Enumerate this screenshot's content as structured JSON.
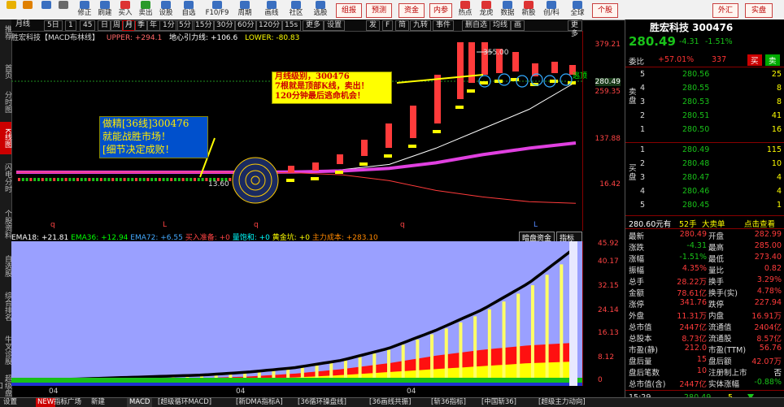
{
  "toolbar": {
    "buttons": [
      "",
      "修正",
      "刷建",
      "买入",
      "卖出",
      "设股",
      "自选",
      "F10/F9",
      "周期",
      "画线",
      "社区",
      "选股"
    ],
    "right_buttons": [
      "组报",
      "预测",
      "资金",
      "内参",
      "热点",
      "龙虎",
      "数据",
      "新股",
      "创/科",
      "全球",
      "个股",
      "外汇",
      "实盘"
    ]
  },
  "sidebar": [
    "推荐",
    "首页",
    "分时图",
    "K线图",
    "闪电分时",
    "个股资料",
    "自选股",
    "综合排名",
    "牛叉诊股",
    "超级盘口"
  ],
  "periods": [
    "月线",
    "5日",
    "1",
    "45",
    "日",
    "周",
    "月",
    "季",
    "年",
    "1分",
    "5分",
    "15分",
    "30分",
    "60分",
    "120分",
    "15s",
    "更多",
    "设置"
  ],
  "period_right": [
    "发",
    "F",
    "简",
    "九转",
    "事件",
    "删自选",
    "均线",
    "画",
    "更多"
  ],
  "stock": {
    "name": "胜宏科技",
    "code": "300476",
    "price": "280.49",
    "change": "-4.31",
    "pct": "-1.51%"
  },
  "indicator_line": {
    "label": "胜宏科技【MACD布林线】",
    "upper": "UPPER: +294.1",
    "center": "地心引力线: +106.6",
    "lower": "LOWER: -80.83"
  },
  "price_axis": [
    "379.21",
    "280.49",
    "259.35",
    "137.88",
    "16.42"
  ],
  "annotations": {
    "max_label": "355.00",
    "min_label": "13.60",
    "escape_label": "逃顶",
    "callout1": [
      "做精[36线]300476",
      "就能战胜市场！",
      "[细节决定成败！"
    ],
    "callout2": [
      "月线级别，300476",
      "7根就是顶部K线，卖出！",
      "120分钟最后逃命机会！"
    ],
    "time_marks": [
      "q",
      "L",
      "q",
      "q",
      "L"
    ]
  },
  "sub_header": {
    "items": [
      "EMA18: +21.81",
      "EMA36: +12.94",
      "EMA72: +6.55",
      "买入准备: +0",
      "量饱和: +0",
      "黄金坑: +0",
      "主力成本: +283.10"
    ],
    "buttons": [
      "暗盘资金",
      "指标说明"
    ]
  },
  "sub_axis": [
    "45.92",
    "40.17",
    "32.15",
    "24.14",
    "16.13",
    "8.12",
    "0"
  ],
  "x_labels": [
    "04",
    "04",
    "04"
  ],
  "quote": {
    "title": "胜宏科技 300476",
    "price": "280.49",
    "chg": "-4.31",
    "pct": "-1.51%",
    "weibi_label": "委比",
    "weibi": "+57.01%",
    "weicha": "337",
    "buy": "买",
    "sell": "卖",
    "sell_side": "卖盘",
    "buy_side": "买盘",
    "asks": [
      [
        "5",
        "280.56",
        "25"
      ],
      [
        "4",
        "280.55",
        "8"
      ],
      [
        "3",
        "280.53",
        "8"
      ],
      [
        "2",
        "280.51",
        "41"
      ],
      [
        "1",
        "280.50",
        "16"
      ]
    ],
    "bids": [
      [
        "1",
        "280.49",
        "115"
      ],
      [
        "2",
        "280.48",
        "10"
      ],
      [
        "3",
        "280.47",
        "4"
      ],
      [
        "4",
        "280.46",
        "4"
      ],
      [
        "5",
        "280.45",
        "1"
      ]
    ],
    "big_order": "280.60元有",
    "big_hand": "52手",
    "big_flag": "大卖单",
    "click": "点击查看",
    "stats": [
      [
        "最新",
        "280.49",
        "开盘",
        "282.99"
      ],
      [
        "涨跌",
        "-4.31",
        "最高",
        "285.00"
      ],
      [
        "涨幅",
        "-1.51%",
        "最低",
        "273.40"
      ],
      [
        "振幅",
        "4.35%",
        "量比",
        "0.82"
      ],
      [
        "总手",
        "28.22万",
        "换手",
        "3.29%"
      ],
      [
        "金额",
        "78.61亿",
        "换手(实)",
        "4.78%"
      ],
      [
        "涨停",
        "341.76",
        "跌停",
        "227.94"
      ],
      [
        "外盘",
        "11.31万",
        "内盘",
        "16.91万"
      ],
      [
        "总市值",
        "2447亿",
        "流通值",
        "2404亿"
      ],
      [
        "总股本",
        "8.73亿",
        "流通股",
        "8.57亿"
      ],
      [
        "市盈(静)",
        "212.0",
        "市盈(TTM)",
        "56.76"
      ],
      [
        "盘后量",
        "15",
        "盘后额",
        "42.07万"
      ],
      [
        "盘后笔数",
        "10",
        "注册制上市",
        "否"
      ],
      [
        "总市值(含)",
        "2447亿",
        "实体涨幅",
        "-0.88%"
      ]
    ],
    "time": "15:29",
    "last_price": "280.49",
    "last_vol": "5",
    "colors": {
      "up": "#ff3b3b",
      "down": "#19c219",
      "neutral": "#ffffff",
      "accent": "#ffff00"
    }
  },
  "tabs": [
    "设置",
    "NEW",
    "指标广场",
    "新建",
    "MACD",
    "[超级循环MACD]",
    "[新DMA指标A]",
    "[36循环操盘线]",
    "[36画线共振]",
    "[斩36指标]",
    "[中国斩36]",
    "[超级主力动向]"
  ],
  "chart_data": {
    "type": "line",
    "title": "胜宏科技 300476 月线",
    "price_range": [
      0,
      379.21
    ],
    "series": [
      {
        "name": "UPPER",
        "values": [
          16,
          16,
          16,
          16,
          16,
          16,
          18,
          24,
          40,
          90,
          150,
          210,
          294
        ]
      },
      {
        "name": "地心引力线",
        "values": [
          16,
          16,
          16,
          16,
          16,
          16,
          17,
          20,
          28,
          45,
          70,
          90,
          106
        ]
      },
      {
        "name": "LOWER",
        "values": [
          16,
          16,
          16,
          16,
          16,
          16,
          14,
          8,
          -10,
          -40,
          -60,
          -75,
          -80
        ]
      }
    ],
    "sub_chart": {
      "ylim": [
        0,
        45.92
      ],
      "series": [
        {
          "name": "EMA18",
          "values": [
            0,
            0.5,
            1,
            1.5,
            2,
            3,
            4.5,
            7,
            11,
            17,
            24,
            33,
            45
          ]
        },
        {
          "name": "EMA36",
          "values": [
            0,
            0.2,
            0.4,
            0.6,
            1,
            1.5,
            2.5,
            4,
            6,
            8.5,
            10.5,
            12,
            12.9
          ]
        },
        {
          "name": "EMA72",
          "values": [
            0,
            0.1,
            0.2,
            0.3,
            0.5,
            0.8,
            1.2,
            2,
            3,
            4,
            5,
            6,
            6.55
          ]
        }
      ]
    }
  }
}
